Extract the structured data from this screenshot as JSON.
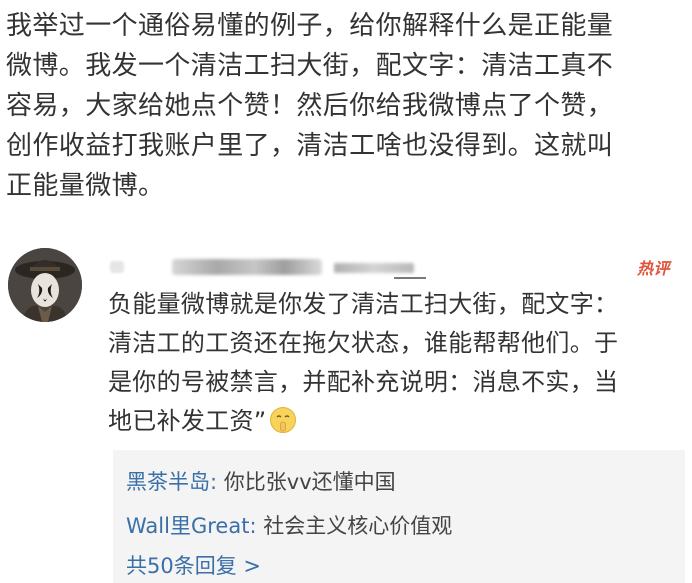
{
  "post": {
    "lines": [
      "我举过一个通俗易懂的例子，给你解释什么是正能量",
      "微博。我发一个清洁工扫大街，配文字：清洁工真不",
      "容易，大家给她点个赞！然后你给我微博点了个赞，",
      "创作收益打我账户里了，清洁工啥也没得到。这就叫",
      "正能量微博。"
    ]
  },
  "comment": {
    "avatar_icon": "avatar-icon",
    "badge": "热评",
    "lines": [
      "负能量微博就是你发了清洁工扫大街，配文字：",
      "清洁工的工资还在拖欠状态，谁能帮帮他们。于",
      "是你的号被禁言，并配补充说明：消息不实，当",
      "地已补发工资”"
    ],
    "emoji_icon": "shushing-face-emoji"
  },
  "replies": {
    "items": [
      {
        "author": "黑茶半岛",
        "separator": ": ",
        "text": "你比张vv还懂中国"
      },
      {
        "author": "Wall里Great",
        "separator": ": ",
        "text": "社会主义核心价值观"
      }
    ],
    "more": "共50条回复 >"
  },
  "colors": {
    "text": "#333333",
    "link": "#3b6fa8",
    "badge": "#e0543c",
    "reply_bg": "#f4f4f4"
  }
}
